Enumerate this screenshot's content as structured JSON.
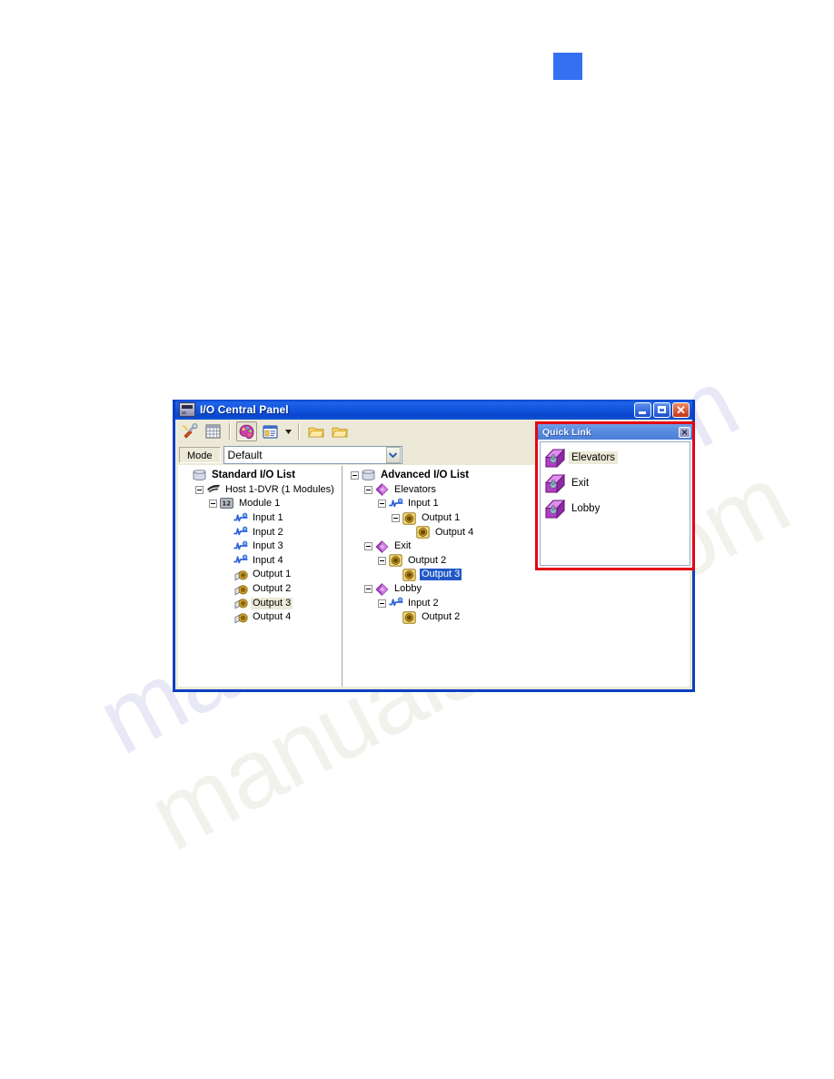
{
  "page": {
    "watermark": "manualslive.com",
    "watermark_shadow": "manualslive.com",
    "blue_marker_color": "#3670f2"
  },
  "window": {
    "title": "I/O Central Panel",
    "title_icon": "io-panel-icon",
    "controls": {
      "minimize": "_",
      "maximize": "□",
      "close": "✕"
    },
    "toolbar": {
      "buttons": [
        {
          "name": "setup-wrench-icon",
          "label": "Setup"
        },
        {
          "name": "grid-view-icon",
          "label": "Grid View"
        },
        {
          "name": "io-palette-icon",
          "label": "I/O Palette",
          "pressed": true
        },
        {
          "name": "list-view-icon",
          "label": "List View"
        },
        {
          "name": "dropdown-arrow-icon",
          "label": "More"
        },
        {
          "name": "open-folder-icon",
          "label": "Open"
        },
        {
          "name": "save-folder-icon",
          "label": "Save"
        }
      ]
    },
    "mode": {
      "label": "Mode",
      "value": "Default",
      "options": [
        "Default"
      ]
    }
  },
  "standard_pane": {
    "root": "Standard I/O List",
    "nodes": [
      {
        "label": "Standard I/O List",
        "depth": 0,
        "icon": "list-icon",
        "expander": "none",
        "bold": true,
        "select": "none"
      },
      {
        "label": "Host 1-DVR (1 Modules)",
        "depth": 1,
        "icon": "host-icon",
        "expander": "minus",
        "bold": false,
        "select": "none"
      },
      {
        "label": "Module 1",
        "depth": 2,
        "icon": "module-icon",
        "expander": "minus",
        "bold": false,
        "select": "none"
      },
      {
        "label": "Input 1",
        "depth": 3,
        "icon": "input-icon",
        "expander": "none",
        "bold": false,
        "select": "none"
      },
      {
        "label": "Input 2",
        "depth": 3,
        "icon": "input-icon",
        "expander": "none",
        "bold": false,
        "select": "none"
      },
      {
        "label": "Input 3",
        "depth": 3,
        "icon": "input-icon",
        "expander": "none",
        "bold": false,
        "select": "none"
      },
      {
        "label": "Input 4",
        "depth": 3,
        "icon": "input-icon",
        "expander": "none",
        "bold": false,
        "select": "none"
      },
      {
        "label": "Output 1",
        "depth": 3,
        "icon": "output-icon",
        "expander": "none",
        "bold": false,
        "select": "none"
      },
      {
        "label": "Output 2",
        "depth": 3,
        "icon": "output-icon",
        "expander": "none",
        "bold": false,
        "select": "none"
      },
      {
        "label": "Output 3",
        "depth": 3,
        "icon": "output-icon",
        "expander": "none",
        "bold": false,
        "select": "grey"
      },
      {
        "label": "Output 4",
        "depth": 3,
        "icon": "output-icon",
        "expander": "none",
        "bold": false,
        "select": "none"
      }
    ]
  },
  "advanced_pane": {
    "root": "Advanced I/O List",
    "nodes": [
      {
        "label": "Advanced I/O List",
        "depth": 0,
        "icon": "list-icon",
        "expander": "minus",
        "bold": true,
        "select": "none"
      },
      {
        "label": "Elevators",
        "depth": 1,
        "icon": "group-icon",
        "expander": "minus",
        "bold": false,
        "select": "none"
      },
      {
        "label": "Input 1",
        "depth": 2,
        "icon": "input-icon",
        "expander": "minus",
        "bold": false,
        "select": "none"
      },
      {
        "label": "Output 1",
        "depth": 3,
        "icon": "adv-out-icon",
        "expander": "minus",
        "bold": false,
        "select": "none"
      },
      {
        "label": "Output 4",
        "depth": 4,
        "icon": "adv-out-icon",
        "expander": "none",
        "bold": false,
        "select": "none"
      },
      {
        "label": "Exit",
        "depth": 1,
        "icon": "group-icon",
        "expander": "minus",
        "bold": false,
        "select": "none"
      },
      {
        "label": "Output 2",
        "depth": 2,
        "icon": "adv-out-icon",
        "expander": "minus",
        "bold": false,
        "select": "none"
      },
      {
        "label": "Output 3",
        "depth": 3,
        "icon": "adv-out-icon",
        "expander": "none",
        "bold": false,
        "select": "blue"
      },
      {
        "label": "Lobby",
        "depth": 1,
        "icon": "group-icon",
        "expander": "minus",
        "bold": false,
        "select": "none"
      },
      {
        "label": "Input 2",
        "depth": 2,
        "icon": "input-icon",
        "expander": "minus",
        "bold": false,
        "select": "none"
      },
      {
        "label": "Output 2",
        "depth": 3,
        "icon": "adv-out-icon",
        "expander": "none",
        "bold": false,
        "select": "none"
      }
    ]
  },
  "quick_link": {
    "title": "Quick Link",
    "close_label": "✕",
    "border_color": "#e30613",
    "items": [
      {
        "label": "Elevators",
        "icon": "group-icon",
        "highlighted": true
      },
      {
        "label": "Exit",
        "icon": "group-icon",
        "highlighted": false
      },
      {
        "label": "Lobby",
        "icon": "group-icon",
        "highlighted": false
      }
    ]
  }
}
